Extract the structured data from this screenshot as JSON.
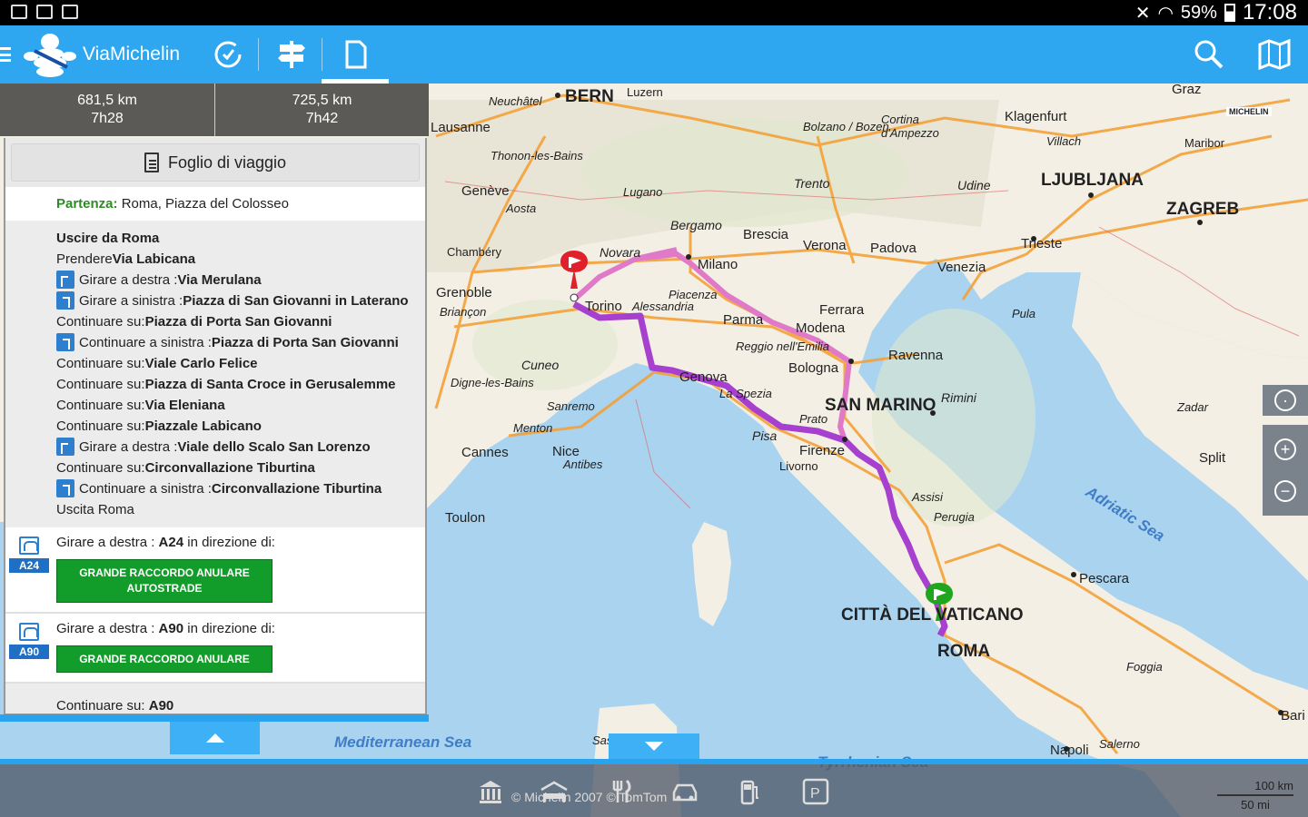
{
  "status_bar": {
    "battery": "59%",
    "time": "17:08"
  },
  "app": {
    "title": "ViaMichelin",
    "brand_color": "#2ea7f0"
  },
  "toolbar": {
    "icons": [
      "history-icon",
      "signpost-icon",
      "roadbook-icon"
    ],
    "active": "roadbook-icon",
    "right_icons": [
      "search-icon",
      "map-icon"
    ]
  },
  "route_summary": [
    {
      "distance": "681,5 km",
      "time": "7h28"
    },
    {
      "distance": "725,5 km",
      "time": "7h42"
    }
  ],
  "roadbook": {
    "header": "Foglio di viaggio",
    "departure_label": "Partenza:",
    "departure_value": "Roma, Piazza del Colosseo",
    "steps": [
      {
        "icon": "",
        "text": "",
        "bold": "Uscire da Roma"
      },
      {
        "icon": "",
        "text": "Prendere ",
        "bold": "Via Labicana"
      },
      {
        "icon": "turn-right",
        "text": "Girare a destra : ",
        "bold": "Via Merulana"
      },
      {
        "icon": "turn-left",
        "text": "Girare a sinistra : ",
        "bold": "Piazza di San Giovanni in Laterano"
      },
      {
        "icon": "",
        "text": "Continuare su: ",
        "bold": "Piazza di Porta San Giovanni"
      },
      {
        "icon": "turn-left",
        "text": "Continuare a sinistra : ",
        "bold": "Piazza di Porta San Giovanni"
      },
      {
        "icon": "",
        "text": "Continuare su: ",
        "bold": "Viale Carlo Felice"
      },
      {
        "icon": "",
        "text": "Continuare su: ",
        "bold": "Piazza di Santa Croce in Gerusalemme"
      },
      {
        "icon": "",
        "text": "Continuare su: ",
        "bold": "Via Eleniana"
      },
      {
        "icon": "",
        "text": "Continuare su: ",
        "bold": "Piazzale Labicano"
      },
      {
        "icon": "turn-right",
        "text": "Girare a destra : ",
        "bold": "Viale dello Scalo San Lorenzo"
      },
      {
        "icon": "",
        "text": "Continuare su: ",
        "bold": "Circonvallazione Tiburtina"
      },
      {
        "icon": "turn-left",
        "text": "Continuare a sinistra : ",
        "bold": "Circonvallazione Tiburtina"
      },
      {
        "icon": "",
        "text": "Uscita Roma",
        "bold": ""
      }
    ],
    "highways": [
      {
        "badge": "A24",
        "prefix": "Girare a destra : ",
        "road": "A24",
        "suffix": " in direzione di:",
        "button": "GRANDE RACCORDO ANULARE AUTOSTRADE"
      },
      {
        "badge": "A90",
        "prefix": "Girare a destra : ",
        "road": "A90",
        "suffix": " in direzione di:",
        "button": "GRANDE RACCORDO ANULARE"
      }
    ],
    "last_step_text": "Continuare su: ",
    "last_step_bold": "A90"
  },
  "map": {
    "route_color": "#a73fcf",
    "alt_route_color": "#e07ac8",
    "start_flag_color": "#1fa51e",
    "end_flag_color": "#e0202a",
    "labels": {
      "big": [
        "BERN",
        "LJUBLJANA",
        "ZAGREB",
        "SAN MARINO",
        "CITTÀ DEL VATICANO",
        "ROMA"
      ],
      "cities": [
        "Luzern",
        "Lausanne",
        "Genève",
        "Grenoble",
        "Chambéry",
        "Torino",
        "Novara",
        "Milano",
        "Bergamo",
        "Brescia",
        "Verona",
        "Padova",
        "Venezia",
        "Trieste",
        "Udine",
        "Trento",
        "Bolzano / Bozen",
        "Cortina d'Ampezzo",
        "Klagenfurt",
        "Villach",
        "Maribor",
        "Graz",
        "Parma",
        "Modena",
        "Ferrara",
        "Bologna",
        "Ravenna",
        "Rimini",
        "Genova",
        "Cuneo",
        "Sanremo",
        "Menton",
        "Nice",
        "Antibes",
        "Cannes",
        "Toulon",
        "Pisa",
        "Livorno",
        "Prato",
        "Firenze",
        "Assisi",
        "Perugia",
        "Pescara",
        "Foggia",
        "Napoli",
        "Salerno",
        "Split",
        "Zadar",
        "Pula",
        "Alessandria",
        "Piacenza",
        "Reggio nell'Emilia",
        "Lugano",
        "Aosta",
        "Neuchâtel",
        "Thonon-les-Bains",
        "Digne-les-Bains",
        "Briançon",
        "La Spezia",
        "Sassari",
        "Bari"
      ],
      "seas": [
        "Adriatic Sea",
        "Mediterranean Sea",
        "Tyrrhenian Sea"
      ],
      "brand": "MICHELIN"
    },
    "copyright": "© Michelin 2007 © TomTom",
    "scale_km": "100 km",
    "scale_mi": "50 mi"
  },
  "poi_bar": [
    "museum-icon",
    "hotel-icon",
    "restaurant-icon",
    "car-rental-icon",
    "fuel-icon",
    "parking-icon"
  ]
}
